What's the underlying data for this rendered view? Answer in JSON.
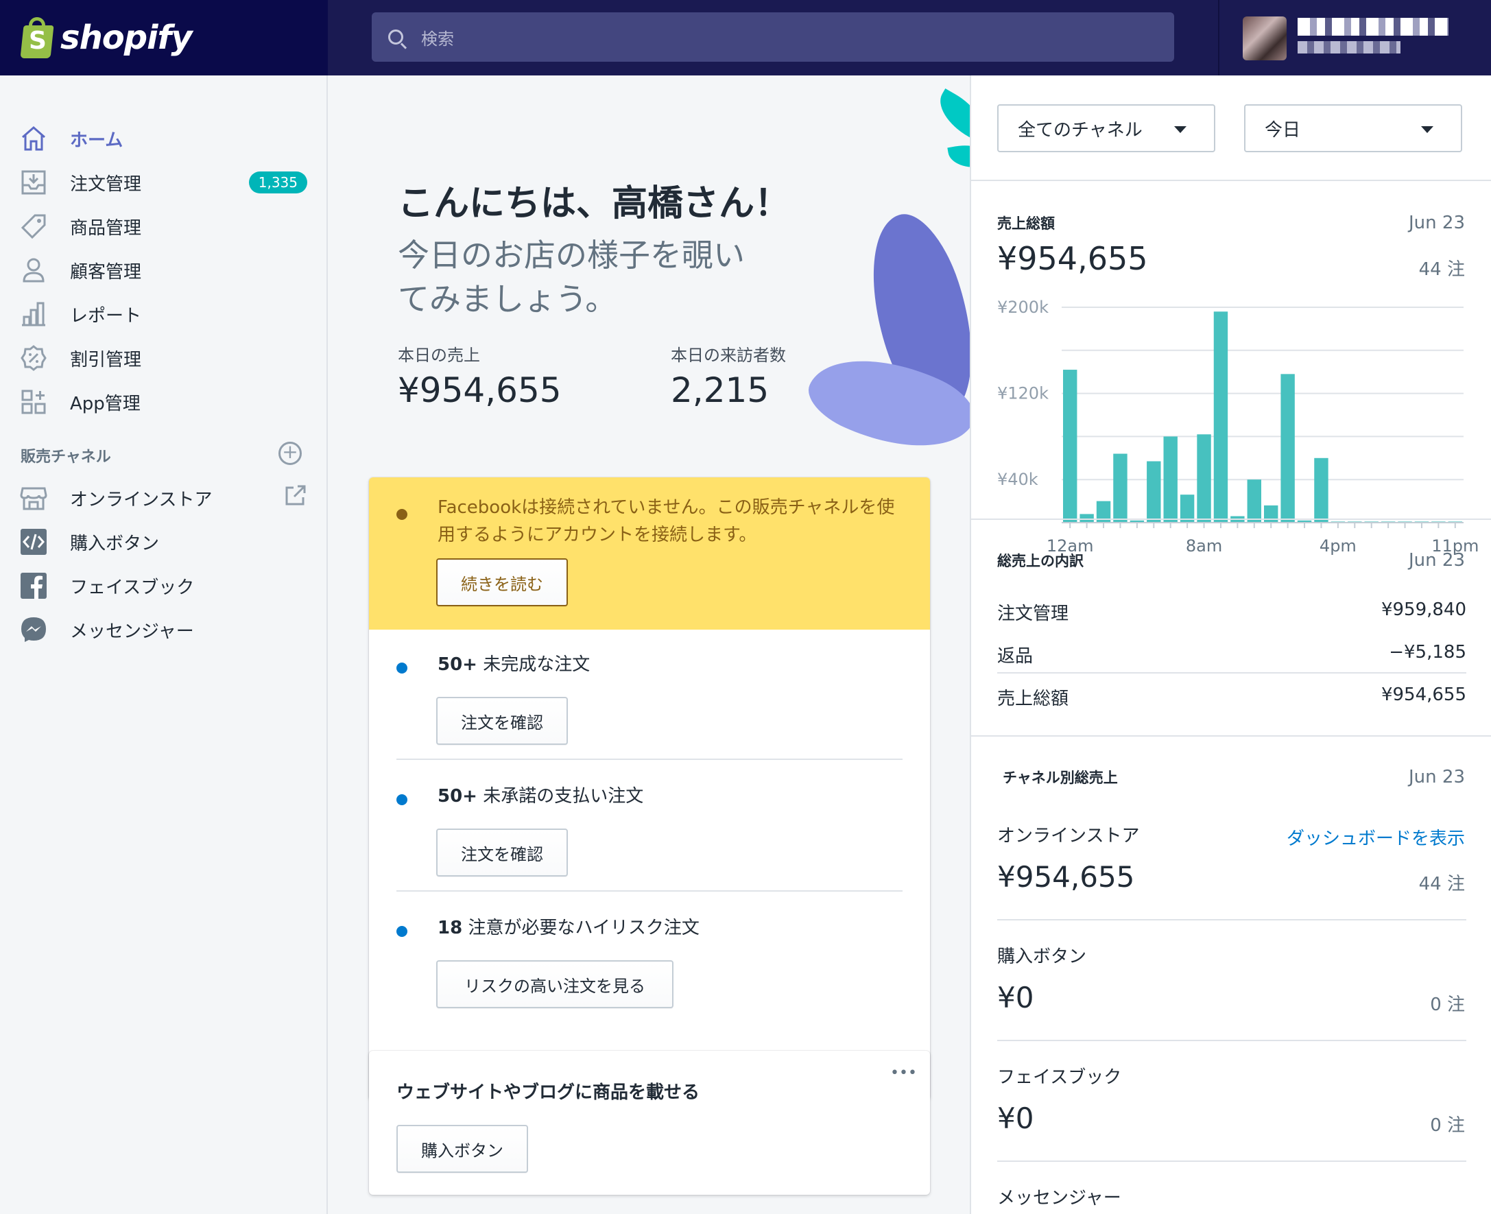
{
  "topbar": {
    "brand": "shopify",
    "search_placeholder": "検索"
  },
  "sidebar": {
    "items": [
      {
        "label": "ホーム",
        "icon": "home-icon"
      },
      {
        "label": "注文管理",
        "icon": "orders-icon",
        "badge": "1,335"
      },
      {
        "label": "商品管理",
        "icon": "tag-icon"
      },
      {
        "label": "顧客管理",
        "icon": "customer-icon"
      },
      {
        "label": "レポート",
        "icon": "reports-icon"
      },
      {
        "label": "割引管理",
        "icon": "discount-icon"
      },
      {
        "label": "App管理",
        "icon": "apps-icon"
      }
    ],
    "channels_heading": "販売チャネル",
    "channels": [
      {
        "label": "オンラインストア",
        "icon": "store-icon"
      },
      {
        "label": "購入ボタン",
        "icon": "code-icon"
      },
      {
        "label": "フェイスブック",
        "icon": "facebook-icon"
      },
      {
        "label": "メッセンジャー",
        "icon": "messenger-icon"
      }
    ]
  },
  "main": {
    "greeting": "こんにちは、高橋さん！",
    "subtitle": "今日のお店の様子を覗いてみましょう。",
    "stats": [
      {
        "label": "本日の売上",
        "value": "¥954,655"
      },
      {
        "label": "本日の来訪者数",
        "value": "2,215"
      }
    ],
    "alert": {
      "text": "Facebookは接続されていません。この販売チャネルを使用するようにアカウントを接続します。",
      "button": "続きを読む"
    },
    "tasks": [
      {
        "count": "50+",
        "text": "未完成な注文",
        "button": "注文を確認"
      },
      {
        "count": "50+",
        "text": "未承諾の支払い注文",
        "button": "注文を確認"
      },
      {
        "count": "18",
        "text": "注意が必要なハイリスク注文",
        "button": "リスクの高い注文を見る"
      }
    ],
    "promo": {
      "title": "ウェブサイトやブログに商品を載せる",
      "menu": "•••",
      "button": "購入ボタン"
    }
  },
  "right": {
    "channel_select": "全てのチャネル",
    "date_select": "今日",
    "sales": {
      "heading": "売上総額",
      "date": "Jun 23",
      "total": "¥954,655",
      "orders": "44 注"
    },
    "breakdown": {
      "heading": "総売上の内訳",
      "date": "Jun 23",
      "rows": [
        {
          "label": "注文管理",
          "value": "¥959,840"
        },
        {
          "label": "返品",
          "value": "−¥5,185"
        },
        {
          "label": "売上総額",
          "value": "¥954,655"
        }
      ]
    },
    "by_channel": {
      "heading": "チャネル別総売上",
      "date": "Jun 23",
      "link": "ダッシュボードを表示",
      "channels": [
        {
          "name": "オンラインストア",
          "value": "¥954,655",
          "orders": "44 注"
        },
        {
          "name": "購入ボタン",
          "value": "¥0",
          "orders": "0 注"
        },
        {
          "name": "フェイスブック",
          "value": "¥0",
          "orders": "0 注"
        },
        {
          "name": "メッセンジャー"
        }
      ]
    }
  },
  "colors": {
    "accent": "#5c6ac4",
    "teal": "#47c1bf",
    "warning": "#ffe16b",
    "link": "#007ace"
  },
  "chart_data": {
    "type": "bar",
    "x": [
      0,
      1,
      2,
      3,
      4,
      5,
      6,
      7,
      8,
      9,
      10,
      11,
      12,
      13,
      14,
      15,
      16,
      17,
      18,
      19,
      20,
      21,
      22,
      23
    ],
    "x_ticklabels": [
      "12am",
      "8am",
      "4pm",
      "11pm"
    ],
    "values": [
      142000,
      8000,
      20000,
      64000,
      2000,
      57000,
      80000,
      26000,
      82000,
      196000,
      6000,
      40000,
      16000,
      138000,
      2000,
      60000,
      1000,
      1000,
      1000,
      1000,
      1000,
      1000,
      1000,
      1000
    ],
    "yticks": [
      "¥200k",
      "¥120k",
      "¥40k"
    ],
    "ylim": [
      0,
      200000
    ],
    "color": "#47c1bf",
    "grid": true
  }
}
